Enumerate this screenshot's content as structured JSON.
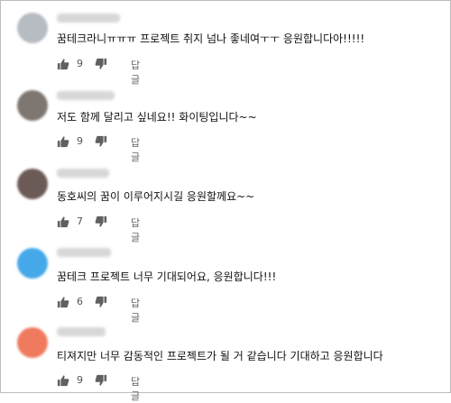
{
  "comments": [
    {
      "text": "꿈테크라니ㅠㅠㅠ 프로젝트 취지 넘나 좋네여ㅜㅜ 응원합니다아!!!!!",
      "likes": "9",
      "reply_label": "답글",
      "avatar_color": "#b7bcc3"
    },
    {
      "text": "저도 함께 달리고 싶네요!! 화이팅입니다~~",
      "likes": "9",
      "reply_label": "답글",
      "avatar_color": "#7e7670"
    },
    {
      "text": "동호씨의 꿈이 이루어지시길 응원할께요~~",
      "likes": "7",
      "reply_label": "답글",
      "avatar_color": "#6c5a56"
    },
    {
      "text": "꿈테크 프로젝트 너무 기대되어요, 응원합니다!!!",
      "likes": "6",
      "reply_label": "답글",
      "avatar_color": "#45a8e8"
    },
    {
      "text": "티져지만 너무 감동적인 프로젝트가 될 거 같습니다  기대하고 응원합니다",
      "likes": "9",
      "reply_label": "답글",
      "avatar_color": "#f07a5e"
    }
  ]
}
